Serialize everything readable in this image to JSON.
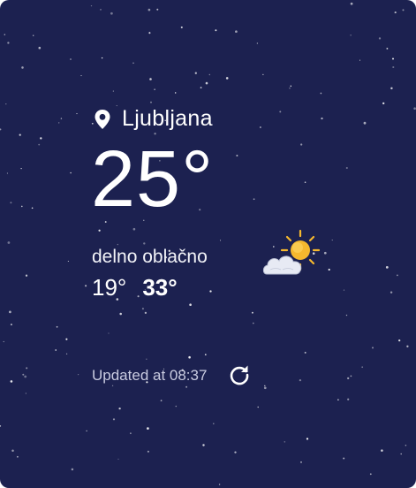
{
  "weather": {
    "city": "Ljubljana",
    "temperature": "25°",
    "condition": "delno oblačno",
    "min": "19°",
    "max": "33°",
    "updated": "Updated at 08:37",
    "icon": "partly-cloudy-sun-icon"
  },
  "colors": {
    "background": "#1c2150",
    "text": "#ffffff",
    "muted": "#c9cbe0",
    "sun": "#f5b82e"
  }
}
